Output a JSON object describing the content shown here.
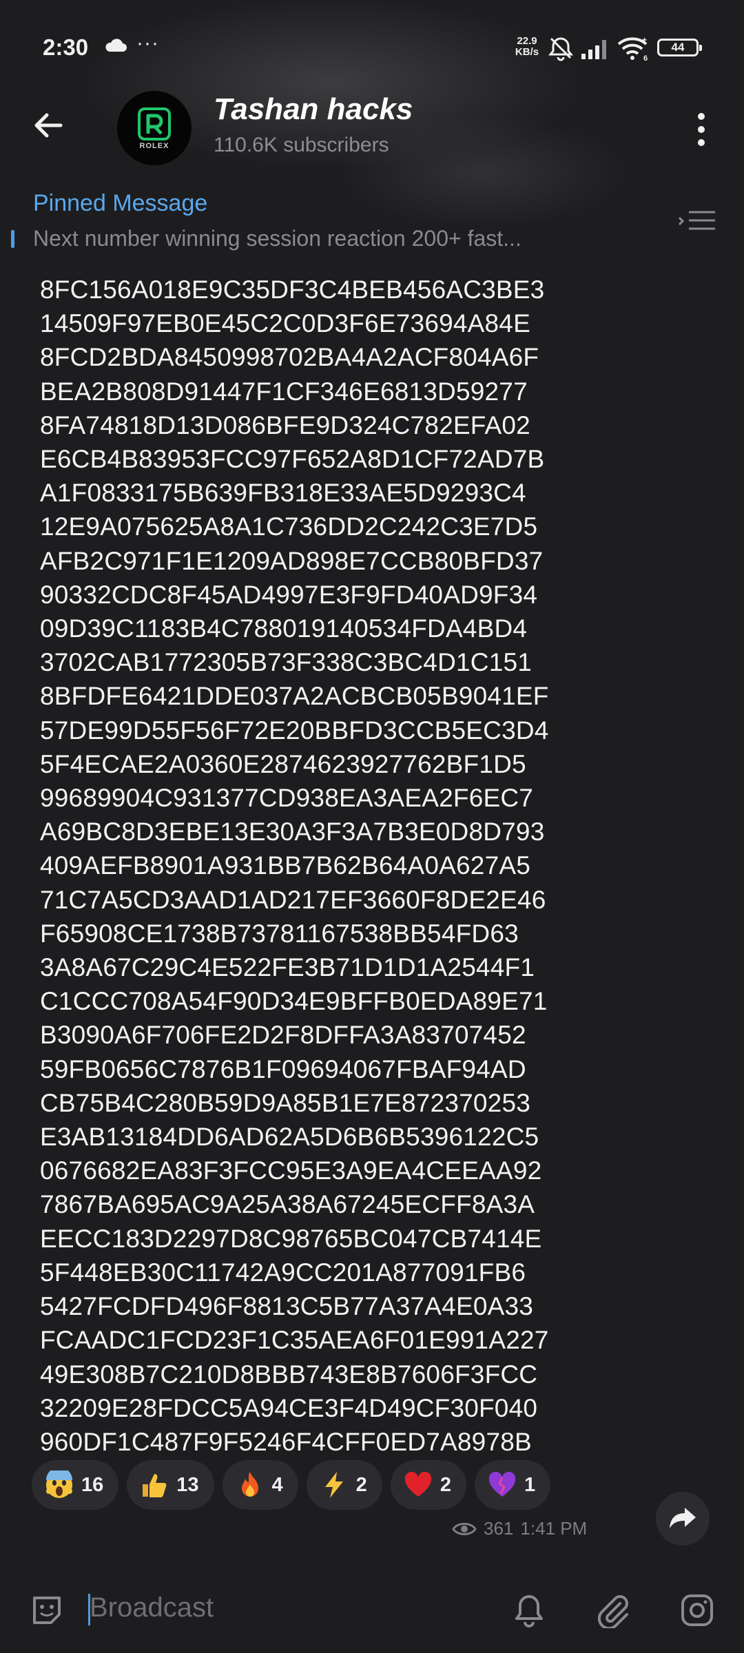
{
  "status_bar": {
    "time": "2:30",
    "dots": "···",
    "speed_value": "22.9",
    "speed_unit": "KB/s",
    "battery": "44"
  },
  "header": {
    "title": "Tashan hacks",
    "subscribers": "110.6K subscribers",
    "avatar_text": "ROLEX"
  },
  "pinned": {
    "title": "Pinned Message",
    "text": "Next number winning session reaction 200+ fast..."
  },
  "message": {
    "lines": [
      "8FC156A018E9C35DF3C4BEB456AC3BE3",
      "14509F97EB0E45C2C0D3F6E73694A84E",
      "8FCD2BDA8450998702BA4A2ACF804A6F",
      "BEA2B808D91447F1CF346E6813D59277",
      "8FA74818D13D086BFE9D324C782EFA02",
      "E6CB4B83953FCC97F652A8D1CF72AD7B",
      "A1F0833175B639FB318E33AE5D9293C4",
      "12E9A075625A8A1C736DD2C242C3E7D5",
      "AFB2C971F1E1209AD898E7CCB80BFD37",
      "90332CDC8F45AD4997E3F9FD40AD9F34",
      "09D39C1183B4C788019140534FDA4BD4",
      "3702CAB1772305B73F338C3BC4D1C151",
      "8BFDFE6421DDE037A2ACBCB05B9041EF",
      "57DE99D55F56F72E20BBFD3CCB5EC3D4",
      "5F4ECAE2A0360E2874623927762BF1D5",
      "99689904C931377CD938EA3AEA2F6EC7",
      "A69BC8D3EBE13E30A3F3A7B3E0D8D793",
      "409AEFB8901A931BB7B62B64A0A627A5",
      "71C7A5CD3AAD1AD217EF3660F8DE2E46",
      "F65908CE1738B73781167538BB54FD63",
      "3A8A67C29C4E522FE3B71D1D1A2544F1",
      "C1CCC708A54F90D34E9BFFB0EDA89E71",
      "B3090A6F706FE2D2F8DFFA3A83707452",
      "59FB0656C7876B1F09694067FBAF94AD",
      "CB75B4C280B59D9A85B1E7E872370253",
      "E3AB13184DD6AD62A5D6B6B5396122C5",
      "0676682EA83F3FCC95E3A9EA4CEEAA92",
      "7867BA695AC9A25A38A67245ECFF8A3A",
      "EECC183D2297D8C98765BC047CB7414E",
      "5F448EB30C11742A9CC201A877091FB6",
      "5427FCDFD496F8813C5B77A37A4E0A33",
      "FCAADC1FCD23F1C35AEA6F01E991A227",
      "49E308B7C210D8BBB743E8B7606F3FCC",
      "32209E28FDCC5A94CE3F4D49CF30F040",
      "960DF1C487F9F5246F4CFF0ED7A8978B"
    ],
    "views": "361",
    "time": "1:41 PM"
  },
  "reactions": [
    {
      "icon": "scream-emoji-icon",
      "count": "16"
    },
    {
      "icon": "thumbs-up-emoji-icon",
      "count": "13"
    },
    {
      "icon": "fire-emoji-icon",
      "count": "4"
    },
    {
      "icon": "lightning-emoji-icon",
      "count": "2"
    },
    {
      "icon": "heart-emoji-icon",
      "count": "2"
    },
    {
      "icon": "broken-heart-emoji-icon",
      "count": "1"
    }
  ],
  "bottom_bar": {
    "placeholder": "Broadcast"
  },
  "colors": {
    "background": "#1d1d1f",
    "accent": "#5aa8ee",
    "reaction_bg": "#2c2c30"
  }
}
